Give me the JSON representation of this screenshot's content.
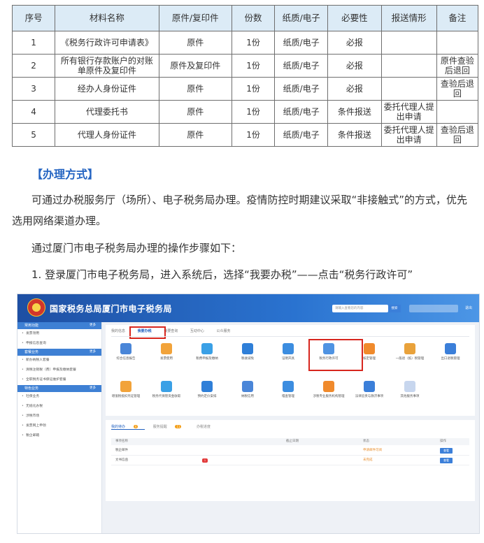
{
  "table": {
    "headers": [
      "序号",
      "材料名称",
      "原件/复印件",
      "份数",
      "纸质/电子",
      "必要性",
      "报送情形",
      "备注"
    ],
    "rows": [
      [
        "1",
        "《税务行政许可申请表》",
        "原件",
        "1份",
        "纸质/电子",
        "必报",
        "",
        ""
      ],
      [
        "2",
        "所有银行存款账户的对账单原件及复印件",
        "原件及复印件",
        "1份",
        "纸质/电子",
        "必报",
        "",
        "原件查验后退回"
      ],
      [
        "3",
        "经办人身份证件",
        "原件",
        "1份",
        "纸质/电子",
        "必报",
        "",
        "查验后退回"
      ],
      [
        "4",
        "代理委托书",
        "原件",
        "1份",
        "纸质/电子",
        "条件报送",
        "委托代理人提出申请",
        ""
      ],
      [
        "5",
        "代理人身份证件",
        "原件",
        "1份",
        "纸质/电子",
        "条件报送",
        "委托代理人提出申请",
        "查验后退回"
      ]
    ]
  },
  "section_title": "【办理方式】",
  "paragraph1": "可通过办税服务厅（场所）、电子税务局办理。疫情防控时期建议采取“非接触式”的方式，优先选用网络渠道办理。",
  "paragraph2": "通过厦门市电子税务局办理的操作步骤如下：",
  "paragraph3": "1. 登录厦门市电子税务局，进入系统后，选择“我要办税”——点击“税务行政许可”",
  "screenshot": {
    "site_title": "国家税务总局厦门市电子税务局",
    "search_placeholder": "请输入查看您的内容",
    "search_button": "搜索",
    "logout": "退出",
    "sidebar": [
      {
        "group": "常用功能",
        "more": "更多",
        "items": [
          "发票领用",
          "申报信息查询"
        ]
      },
      {
        "group": "套餐业务",
        "more": "更多",
        "items": [
          "新办纳税人套餐",
          "清税注销税（费）申报及缴纳套餐",
          "全职税务证书保证维护套餐"
        ]
      },
      {
        "group": "特色业务",
        "more": "更多",
        "items": [
          "社保业务",
          "无纸化办税",
          "涉税市场",
          "发票网上申领",
          "税企邮箱"
        ]
      }
    ],
    "tabs": [
      "我的信息",
      "我要办税",
      "我要查询",
      "互动中心",
      "公众服务"
    ],
    "icons_row1": [
      "综合信息报告",
      "发票使用",
      "税费申报及缴纳",
      "税收减免",
      "证明开具",
      "税务行政许可",
      "核定管理",
      "一般退（抵）税管理",
      "出口退税管理"
    ],
    "icons_row2": [
      "增值税抵扣凭证管理",
      "税务代保管资金收取",
      "预约定价安排",
      "纳税信用",
      "稽查管理",
      "涉税专业服务机构管理",
      "法律追责与救济事项",
      "其他服务事项"
    ],
    "lower_tabs": [
      "我的待办",
      "服务提醒",
      "办税进度"
    ],
    "lower_badges": [
      "4",
      "11"
    ],
    "table_headers": [
      "事项名称",
      "截止日期",
      "状态",
      "操作"
    ],
    "rows": [
      {
        "name": "税企邮件",
        "badge": "",
        "status": "申请邮件可阅",
        "op": "查看"
      },
      {
        "name": "文书信函",
        "badge": "1",
        "status": "未完成",
        "op": "查看"
      }
    ]
  },
  "colors": {
    "header_bg": "#dcebf6",
    "section_title": "#2464c2",
    "highlight_box": "#d7261e",
    "portal_blue": "#1e4fa3"
  }
}
